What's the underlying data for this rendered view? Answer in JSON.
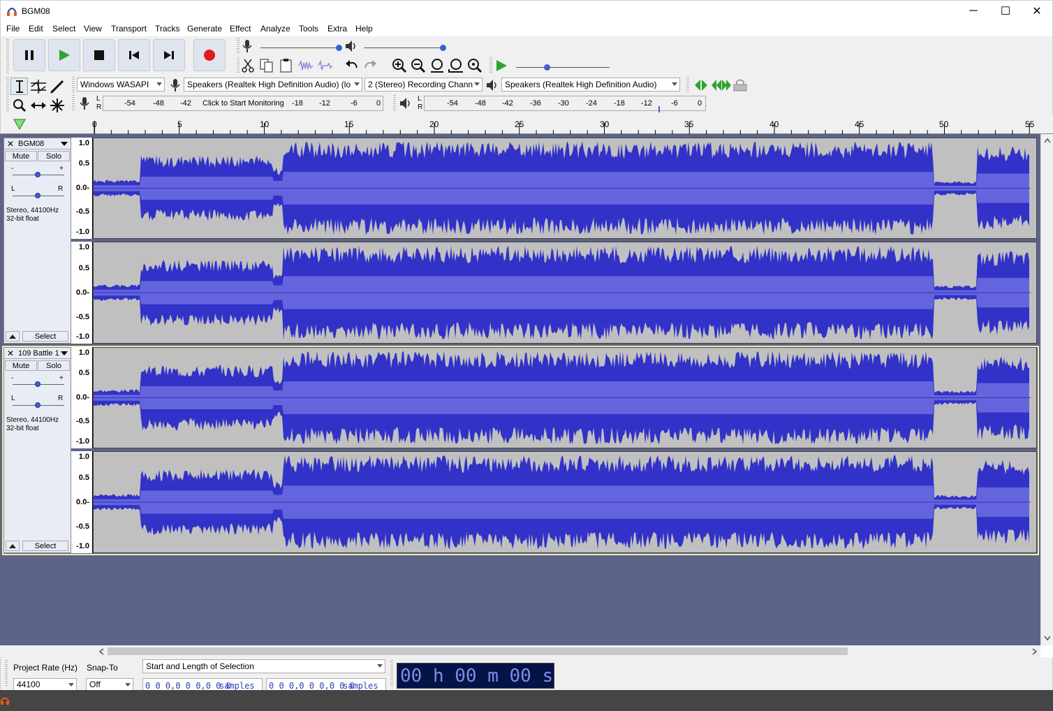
{
  "window": {
    "title": "BGM08",
    "minimize": "─",
    "maximize": "☐",
    "close": "✕"
  },
  "menu": [
    "File",
    "Edit",
    "Select",
    "View",
    "Transport",
    "Tracks",
    "Generate",
    "Effect",
    "Analyze",
    "Tools",
    "Extra",
    "Help"
  ],
  "devices": {
    "host": "Windows WASAPI",
    "recording_device": "Speakers (Realtek High Definition Audio) (lo",
    "channels": "2 (Stereo) Recording Chann",
    "playback_device": "Speakers (Realtek High Definition Audio)"
  },
  "record_meter": {
    "lr": [
      "L",
      "R"
    ],
    "ticks": [
      "-54",
      "-48",
      "-42",
      "-18",
      "-12",
      "-6",
      "0"
    ],
    "hint": "Click to Start Monitoring"
  },
  "play_meter": {
    "lr": [
      "L",
      "R"
    ],
    "ticks": [
      "-54",
      "-48",
      "-42",
      "-36",
      "-30",
      "-24",
      "-18",
      "-12",
      "-6",
      "0"
    ]
  },
  "timeline": {
    "ticks": [
      "0",
      "5",
      "10",
      "15",
      "20",
      "25",
      "30",
      "35",
      "40",
      "45",
      "50",
      "55"
    ]
  },
  "amplitude_labels": [
    "1.0",
    "0.5",
    "0.0-",
    "-0.5",
    "-1.0"
  ],
  "tracks": [
    {
      "name": "BGM08",
      "mute": "Mute",
      "solo": "Solo",
      "gain_label": "-",
      "gain_plus": "+",
      "pan_l": "L",
      "pan_r": "R",
      "info1": "Stereo, 44100Hz",
      "info2": "32-bit float",
      "select": "Select",
      "selected": false
    },
    {
      "name": "109 Battle 1",
      "mute": "Mute",
      "solo": "Solo",
      "gain_label": "-",
      "gain_plus": "+",
      "pan_l": "L",
      "pan_r": "R",
      "info1": "Stereo, 44100Hz",
      "info2": "32-bit float",
      "select": "Select",
      "selected": true
    }
  ],
  "status": {
    "project_rate_label": "Project Rate (Hz)",
    "project_rate": "44100",
    "snap_to_label": "Snap-To",
    "snap_to": "Off",
    "selection_mode": "Start and Length of Selection",
    "start_value": "0 0 0,0 0 0,0 0 0",
    "start_unit": "samples",
    "length_value": "0 0 0,0 0 0,0 0 0",
    "length_unit": "samples",
    "audio_position": "00 h 00 m 00 s"
  },
  "colors": {
    "waveform": "#3232c8",
    "waveform_rms": "#6464dc",
    "track_bg": "#c0c0c0",
    "empty_bg": "#5e6487",
    "time_bg": "#061347"
  }
}
